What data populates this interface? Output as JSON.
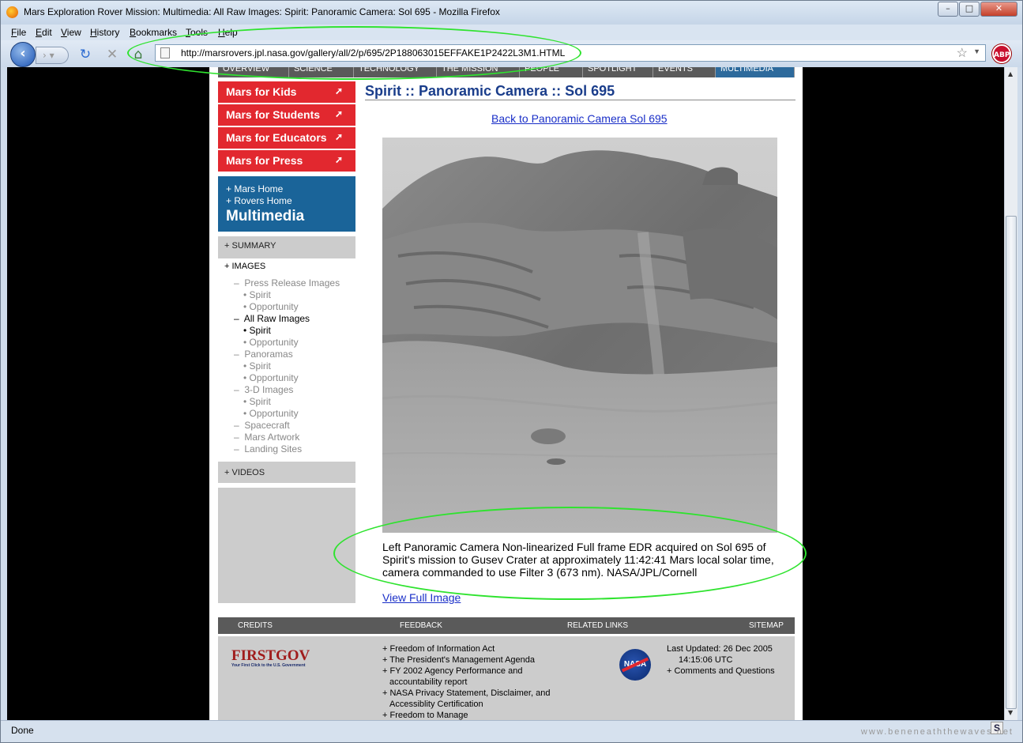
{
  "window": {
    "title": "Mars Exploration Rover Mission: Multimedia: All Raw Images: Spirit: Panoramic Camera: Sol 695 - Mozilla Firefox",
    "minimize": "–",
    "maximize": "□",
    "close": "✕"
  },
  "menu": {
    "items": [
      "File",
      "Edit",
      "View",
      "History",
      "Bookmarks",
      "Tools",
      "Help"
    ]
  },
  "nav": {
    "url": "http://marsrovers.jpl.nasa.gov/gallery/all/2/p/695/2P188063015EFFAKE1P2422L3M1.HTML",
    "abp": "ABP"
  },
  "topnav": {
    "items": [
      "OVERVIEW",
      "SCIENCE",
      "TECHNOLOGY",
      "THE MISSION",
      "PEOPLE",
      "SPOTLIGHT",
      "EVENTS",
      "MULTIMEDIA"
    ]
  },
  "redlinks": [
    "Mars for Kids",
    "Mars for Students",
    "Mars for Educators",
    "Mars for Press"
  ],
  "bluebox": {
    "mars_home": "+ Mars Home",
    "rovers_home": "+ Rovers Home",
    "section": "Multimedia"
  },
  "sidebar": {
    "summary": "+ SUMMARY",
    "images": "+ IMAGES",
    "videos": "+ VIDEOS",
    "tree": {
      "press": "Press Release Images",
      "press_spirit": "Spirit",
      "press_opp": "Opportunity",
      "raw": "All Raw Images",
      "raw_spirit": "Spirit",
      "raw_opp": "Opportunity",
      "pano": "Panoramas",
      "pano_spirit": "Spirit",
      "pano_opp": "Opportunity",
      "threed": "3-D Images",
      "threed_spirit": "Spirit",
      "threed_opp": "Opportunity",
      "spacecraft": "Spacecraft",
      "artwork": "Mars Artwork",
      "landing": "Landing Sites"
    }
  },
  "main": {
    "heading": "Spirit :: Panoramic Camera :: Sol 695",
    "back_link": "Back to Panoramic Camera Sol 695",
    "caption": "Left Panoramic Camera Non-linearized Full frame EDR acquired on Sol 695 of Spirit's mission to Gusev Crater at approximately 11:42:41 Mars local solar time, camera commanded to use Filter 3 (673 nm). NASA/JPL/Cornell",
    "view_full": "View Full Image"
  },
  "footer": {
    "bar": [
      "CREDITS",
      "FEEDBACK",
      "RELATED LINKS",
      "SITEMAP"
    ],
    "firstgov": "FIRSTGOV",
    "firstgov_tag": "Your First Click to the U.S. Government",
    "links": [
      "+ Freedom of Information Act",
      "+ The President's Management Agenda",
      "+ FY 2002 Agency Performance and",
      "   accountability report",
      "+ NASA Privacy Statement, Disclaimer, and",
      "   Accessiblity Certification",
      "+ Freedom to Manage"
    ],
    "nasa": "NASA",
    "last_updated": "Last Updated: 26 Dec 2005",
    "time": "14:15:06 UTC",
    "comments": "+ Comments and Questions"
  },
  "status": {
    "text": "Done",
    "watermark": "www.beneneaththewaves.net",
    "s_icon": "S"
  },
  "colors": {
    "red": "#e2282f",
    "blue": "#1a6499",
    "heading": "#1a3d8b",
    "highlight": "#2fe32f"
  }
}
